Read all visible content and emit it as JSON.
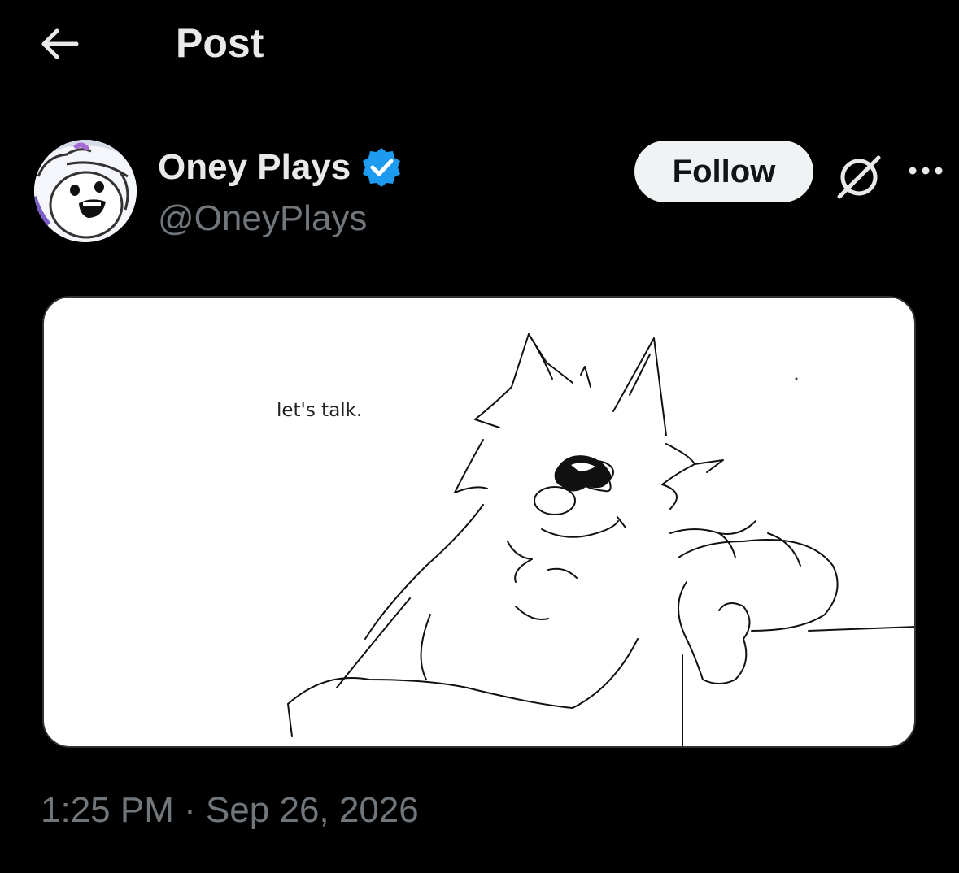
{
  "header": {
    "title": "Post",
    "back_icon": "arrow-left-icon"
  },
  "author": {
    "display_name": "Oney Plays",
    "handle": "@OneyPlays",
    "verified": true,
    "verified_color": "#1d9bf0",
    "avatar_icon": "avatar-cartoon-face"
  },
  "actions": {
    "follow_label": "Follow",
    "grok_icon": "grok-icon",
    "more_icon": "more-horizontal-icon"
  },
  "media": {
    "caption": "let's talk."
  },
  "timestamp": "1:25 PM · Sep 26, 2026",
  "colors": {
    "background": "#000000",
    "primary_text": "#e7e9ea",
    "secondary_text": "#71767b",
    "follow_bg": "#eff3f4",
    "verified": "#1d9bf0"
  }
}
